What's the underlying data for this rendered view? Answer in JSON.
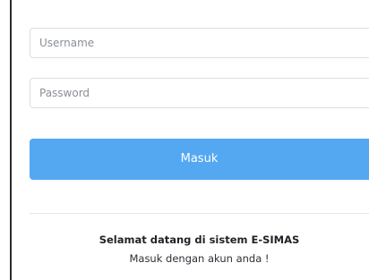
{
  "login_form": {
    "username_placeholder": "Username",
    "password_placeholder": "Password",
    "submit_label": "Masuk"
  },
  "welcome": {
    "title": "Selamat datang di sistem E-SIMAS",
    "subtitle": "Masuk dengan akun anda !"
  },
  "colors": {
    "primary_button": "#54a7f1",
    "input_border": "#d9dde3",
    "divider": "#e3e6ea"
  }
}
